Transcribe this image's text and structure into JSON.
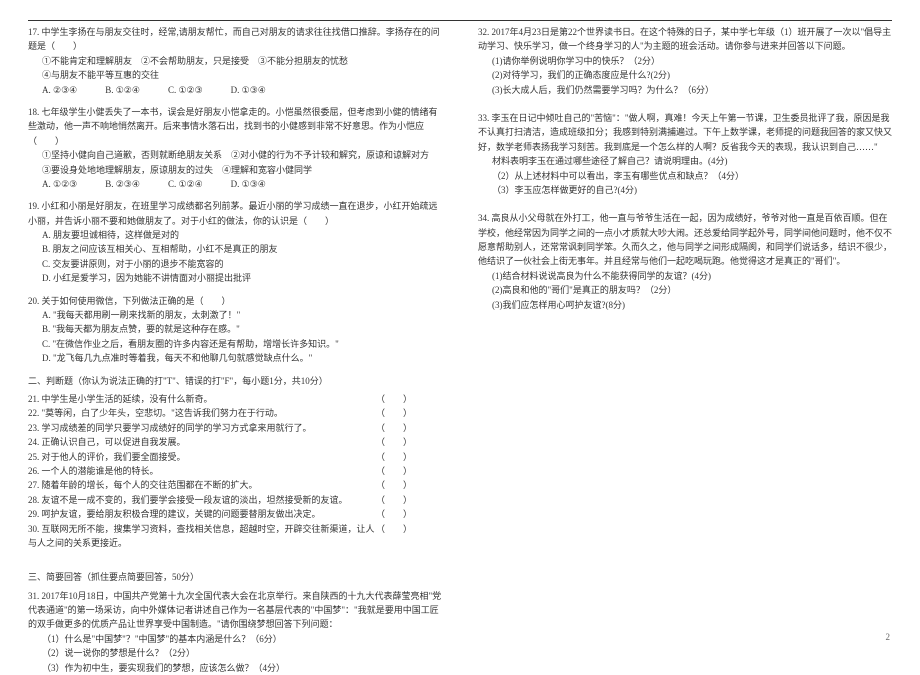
{
  "left": {
    "q17": {
      "stem": "17. 中学生李扬在与朋友交往时，经常,请朋友帮忙，而自己对朋友的请求往往找借口推辞。李扬存在的问题是（　　）",
      "o1": "①不能肯定和理解朋友　②不会帮助朋友，只是接受　③不能分担朋友的忧愁",
      "o2": "④与朋友不能平等互惠的交往",
      "row": [
        "A. ②③④",
        "B. ①②④",
        "C. ①②③",
        "D. ①③④"
      ]
    },
    "q18": {
      "stem": "18. 七年级学生小健丢失了一本书，误会是好朋友小恺拿走的。小恺虽然很委屈，但考虑到小健的情绪有些激动，他一声不响地悄然离开。后来事情水落石出，找到书的小健感到非常不好意思。作为小恺应（　　）",
      "o1": "①坚持小健向自己道歉，否则就断绝朋友关系　②对小健的行为不予计较和解究，原谅和谅解对方　③要设身处地地理解朋友，原谅朋友的过失　④理解和宽容小健同学",
      "row": [
        "A. ①②③",
        "B. ②③④",
        "C. ①②④",
        "D. ①③④"
      ]
    },
    "q19": {
      "stem": "19. 小红和小丽是好朋友，在班里学习成绩都名列前茅。最近小丽的学习成绩一直在退步，小红开始疏远小丽，并告诉小丽不要和她做朋友了。对于小红的做法，你的认识是（　　）",
      "opts": [
        "A. 朋友要坦诚相待，这样做是对的",
        "B. 朋友之间应该互相关心、互相帮助，小红不是真正的朋友",
        "C. 交友要讲原则，对于小丽的退步不能宽容的",
        "D. 小红是爱学习，因为她能不讲情面对小丽提出批评"
      ]
    },
    "q20": {
      "stem": "20. 关于如何使用微信，下列做法正确的是（　　）",
      "opts": [
        "A. \"我每天都用刷一刷来找新的朋友，太刺激了！\"",
        "B. \"我每天都为朋友点赞，要的就是这种存在感。\"",
        "C. \"在微信作业之后，看朋友圈的许多内容还是有帮助，增增长许多知识。\"",
        "D. \"龙飞每几九点准时等着我，每天不和他聊几句就感觉缺点什么。\""
      ]
    },
    "sect2": "二、判断题（你认为说法正确的打\"T\"、错误的打\"F\"，每小题1分，共10分）",
    "judges": [
      "21. 中学生是小学生活的延续，没有什么新奇。",
      "22. \"莫等闲，白了少年头，空悲切。\"这告诉我们努力在于行动。",
      "23. 学习成绩差的同学只要学习成绩好的同学的学习方式拿来用就行了。",
      "24. 正确认识自己，可以促进自我发展。",
      "25. 对于他人的评价，我们要全面接受。",
      "26. 一个人的潜能谁是他的特长。",
      "27. 随着年龄的增长，每个人的交往范围都在不断的扩大。",
      "28. 友谊不是一成不变的，我们要学会接受一段友谊的淡出，坦然接受新的友谊。",
      "29. 呵护友谊，要给朋友积极合理的建议，关键的问题要替朋友做出决定。",
      "30. 互联网无所不能，搜集学习资料，查找相关信息，超越时空，开辟交往新渠道，让人与人之间的关系更接近。"
    ],
    "sect3": "三、简要回答（抓住要点简要回答，50分）",
    "q31": {
      "stem": "31. 2017年10月18日，中国共产党第十九次全国代表大会在北京举行。来自陕西的十九大代表薛莹亮相\"党代表通道\"的第一场采访，向中外媒体记者讲述自己作为一名基层代表的\"中国梦\"：\"我就是要用中国工匠的双手做更多的优质产品让世界享受中国制造。\"请你围绕梦想回答下列问题：",
      "subs": [
        "（1）什么是\"中国梦\"？\"中国梦\"的基本内涵是什么？（6分）",
        "（2）说一说你的梦想是什么？（2分）",
        "（3）作为初中生，要实现我们的梦想，应该怎么做？（4分）"
      ]
    }
  },
  "right": {
    "q32": {
      "stem": "32. 2017年4月23日是第22个世界读书日。在这个特殊的日子，某中学七年级（1）班开展了一次以\"倡导主动学习、快乐学习，做一个终身学习的人\"为主题的班会活动。请你参与进来并回答以下问题。",
      "subs": [
        "(1)请你举例说明你学习中的快乐？（2分）",
        "(2)对待学习，我们的正确态度应是什么?(2分)",
        "(3)长大成人后，我们仍然需要学习吗？为什么？（6分）"
      ]
    },
    "q33": {
      "stem": "33. 李玉在日记中倾吐自己的\"苦恼\"：\"做人啊，真难！今天上午第一节课，卫生委员批评了我，原因是我不认真打扫清洁，造成班级扣分；我感到特别满捕遍过。下午上数学课，老师提的问题我回答的家又快又好，数学老师表扬我学习刻苦。我到底是一个怎么样的人啊？反省我今天的表现，我认识到自己……\"",
      "subs": [
        "材料表明李玉在通过哪些途径了解自己？请说明理由。(4分)",
        "（2）从上述材料中可以看出，李玉有哪些优点和缺点？（4分）",
        "（3）李玉应怎样做更好的自己?(4分)"
      ]
    },
    "q34": {
      "stem": "34. 高良从小父母就在外打工，他一直与爷爷生活在一起，因为成绩好，爷爷对他一直是百依百顺。但在学校，他经常因为同学之间的一点小才质就大吵大闹。还总爱给同学起外号，同学间他问题时，他不仅不愿意帮助别人，还常常讽刺同学笨。久而久之，他与同学之间形成隔阂，和同学们说话多，结识不很少，他结识了一伙社会上街无事年。并且经常与他们一起吃喝玩跑。他觉得这才是真正的\"哥们\"。",
      "subs": [
        "(1)结合材料说说高良为什么不能获得同学的友谊？(4分)",
        "(2)高良和他的\"哥们\"是真正的朋友吗？（2分）",
        "(3)我们应怎样用心呵护友谊?(8分)"
      ]
    }
  },
  "pageno": "2"
}
